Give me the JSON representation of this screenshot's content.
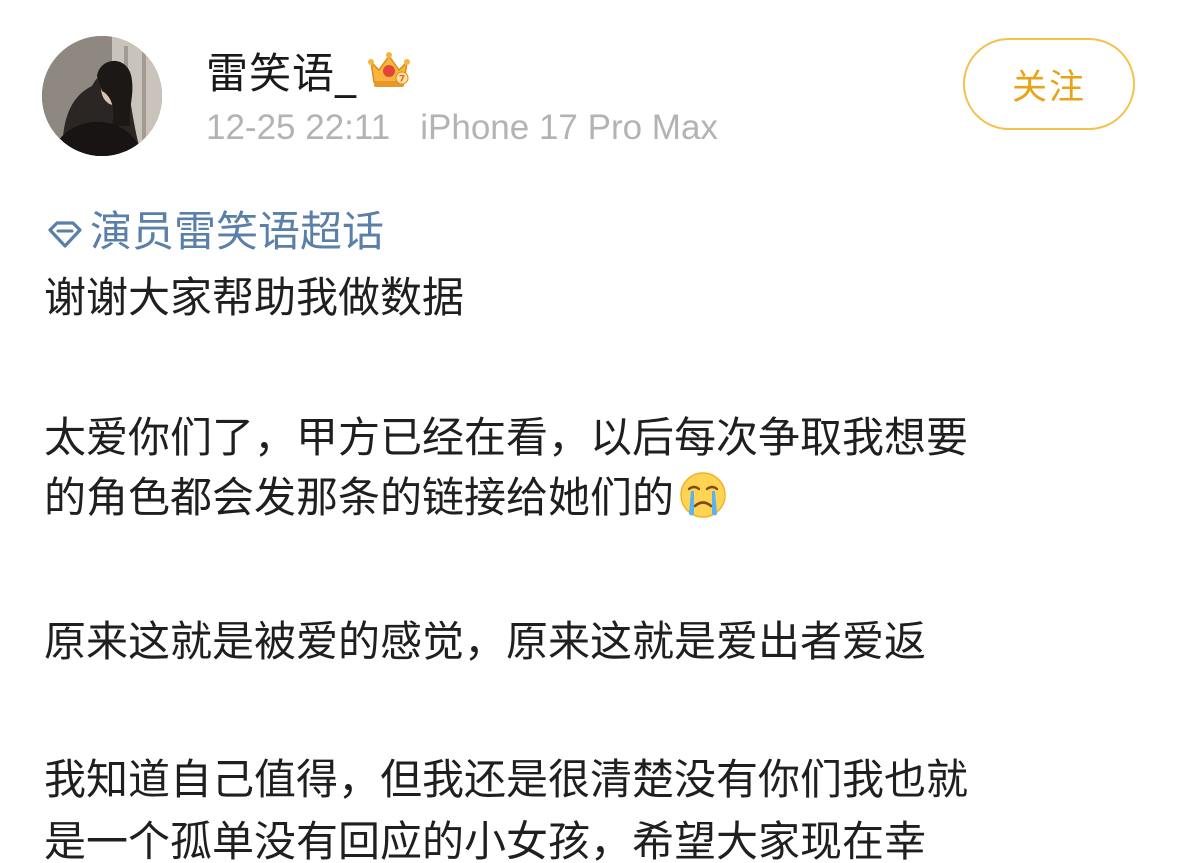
{
  "post": {
    "author": {
      "name": "雷笑语_",
      "timestamp": "12-25 22:11",
      "device": "iPhone 17 Pro Max",
      "badge_icon": "crown-icon"
    },
    "follow_label": "关注",
    "topic_label": "演员雷笑语超话",
    "lines": [
      "谢谢大家帮助我做数据",
      "太爱你们了，甲方已经在看，以后每次争取我想要",
      "的角色都会发那条的链接给她们的",
      "原来这就是被爱的感觉，原来这就是爱出者爱返",
      "我知道自己值得，但我还是很清楚没有你们我也就",
      "是一个孤单没有回应的小女孩，希望大家现在幸"
    ],
    "emoji_icon": "crying-face-icon"
  },
  "colors": {
    "follow_accent": "#e8a317",
    "topic_link": "#5a7fa8",
    "meta_text": "#b3b3b3"
  }
}
